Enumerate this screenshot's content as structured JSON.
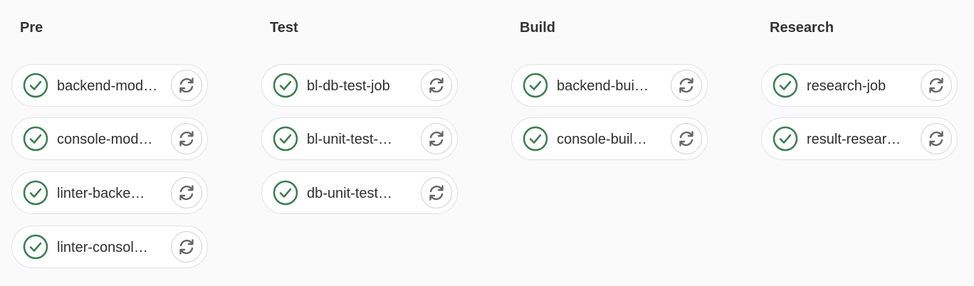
{
  "colors": {
    "success": "#3a7d4f",
    "retry_icon": "#666666"
  },
  "stages": [
    {
      "title": "Pre",
      "jobs": [
        {
          "name": "backend-modu…",
          "status": "success"
        },
        {
          "name": "console-modul…",
          "status": "success"
        },
        {
          "name": "linter-backe…",
          "status": "success"
        },
        {
          "name": "linter-consol…",
          "status": "success"
        }
      ]
    },
    {
      "title": "Test",
      "jobs": [
        {
          "name": "bl-db-test-job",
          "status": "success"
        },
        {
          "name": "bl-unit-test-…",
          "status": "success"
        },
        {
          "name": "db-unit-test…",
          "status": "success"
        }
      ]
    },
    {
      "title": "Build",
      "jobs": [
        {
          "name": "backend-bui…",
          "status": "success"
        },
        {
          "name": "console-buil…",
          "status": "success"
        }
      ]
    },
    {
      "title": "Research",
      "jobs": [
        {
          "name": "research-job",
          "status": "success"
        },
        {
          "name": "result-resear…",
          "status": "success"
        }
      ]
    }
  ]
}
